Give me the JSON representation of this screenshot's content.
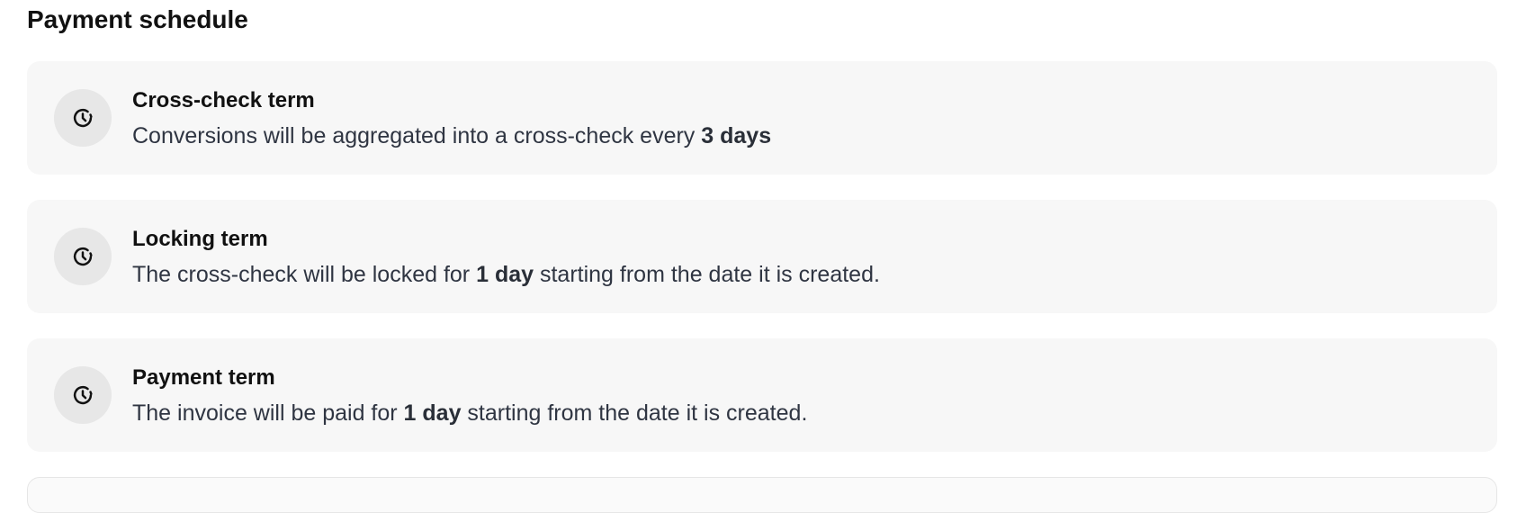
{
  "section": {
    "title": "Payment schedule"
  },
  "cards": [
    {
      "icon": "clock-icon",
      "title": "Cross-check term",
      "desc_before": "Conversions will be aggregated into a cross-check every ",
      "desc_bold": "3 days",
      "desc_after": ""
    },
    {
      "icon": "clock-icon",
      "title": "Locking term",
      "desc_before": "The cross-check will be locked for ",
      "desc_bold": "1 day",
      "desc_after": " starting from the date it is created."
    },
    {
      "icon": "clock-icon",
      "title": "Payment term",
      "desc_before": "The invoice will be paid for ",
      "desc_bold": "1 day",
      "desc_after": " starting from the date it is created."
    }
  ]
}
